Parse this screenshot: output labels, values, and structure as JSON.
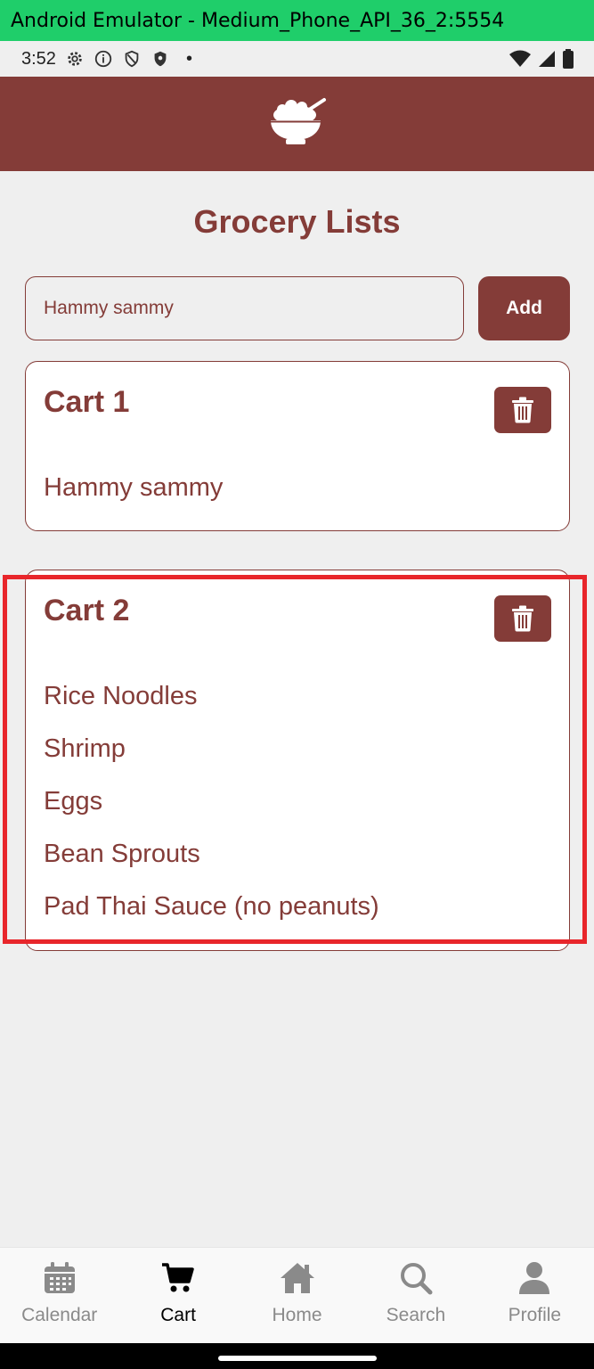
{
  "window": {
    "title": "Android Emulator - Medium_Phone_API_36_2:5554"
  },
  "status_bar": {
    "time": "3:52",
    "dot": "•"
  },
  "app_bar": {
    "logo_icon": "rice-bowl-icon",
    "background": "#843c38"
  },
  "page": {
    "title": "Grocery Lists"
  },
  "new_item": {
    "value": "Hammy sammy",
    "add_label": "Add"
  },
  "carts": [
    {
      "title": "Cart 1",
      "items": [
        "Hammy sammy"
      ]
    },
    {
      "title": "Cart 2",
      "items": [
        "Rice Noodles",
        "Shrimp",
        "Eggs",
        "Bean Sprouts",
        "Pad Thai Sauce (no peanuts)"
      ]
    }
  ],
  "bottom_nav": {
    "active": "Cart",
    "items": [
      {
        "label": "Calendar",
        "icon": "calendar-icon"
      },
      {
        "label": "Cart",
        "icon": "cart-icon"
      },
      {
        "label": "Home",
        "icon": "home-icon"
      },
      {
        "label": "Search",
        "icon": "search-icon"
      },
      {
        "label": "Profile",
        "icon": "profile-icon"
      }
    ]
  },
  "colors": {
    "brand": "#843c38",
    "highlight": "#e8262b",
    "title_bar": "#1fce6a"
  }
}
